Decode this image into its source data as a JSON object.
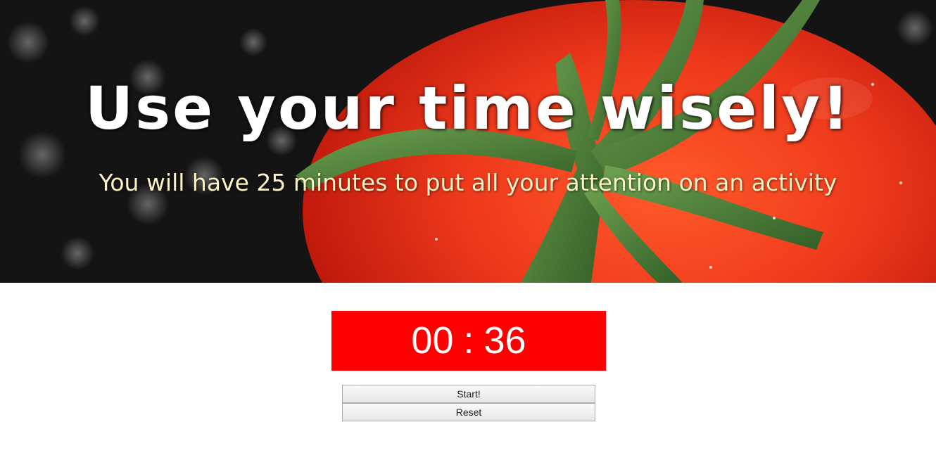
{
  "hero": {
    "headline": "Use your time wisely!",
    "subline": "You will have 25 minutes to put all your attention on an activity",
    "image": "tomato-photo",
    "colors": {
      "background": "#121212",
      "tomato": "#e8301a",
      "stem": "#4f8a3a",
      "headline_text": "#ffffff",
      "subline_text": "#fbf3c7"
    }
  },
  "timer": {
    "minutes": "00",
    "separator": ":",
    "seconds": "36",
    "background": "#ff0000"
  },
  "controls": {
    "start_label": "Start!",
    "reset_label": "Reset"
  }
}
